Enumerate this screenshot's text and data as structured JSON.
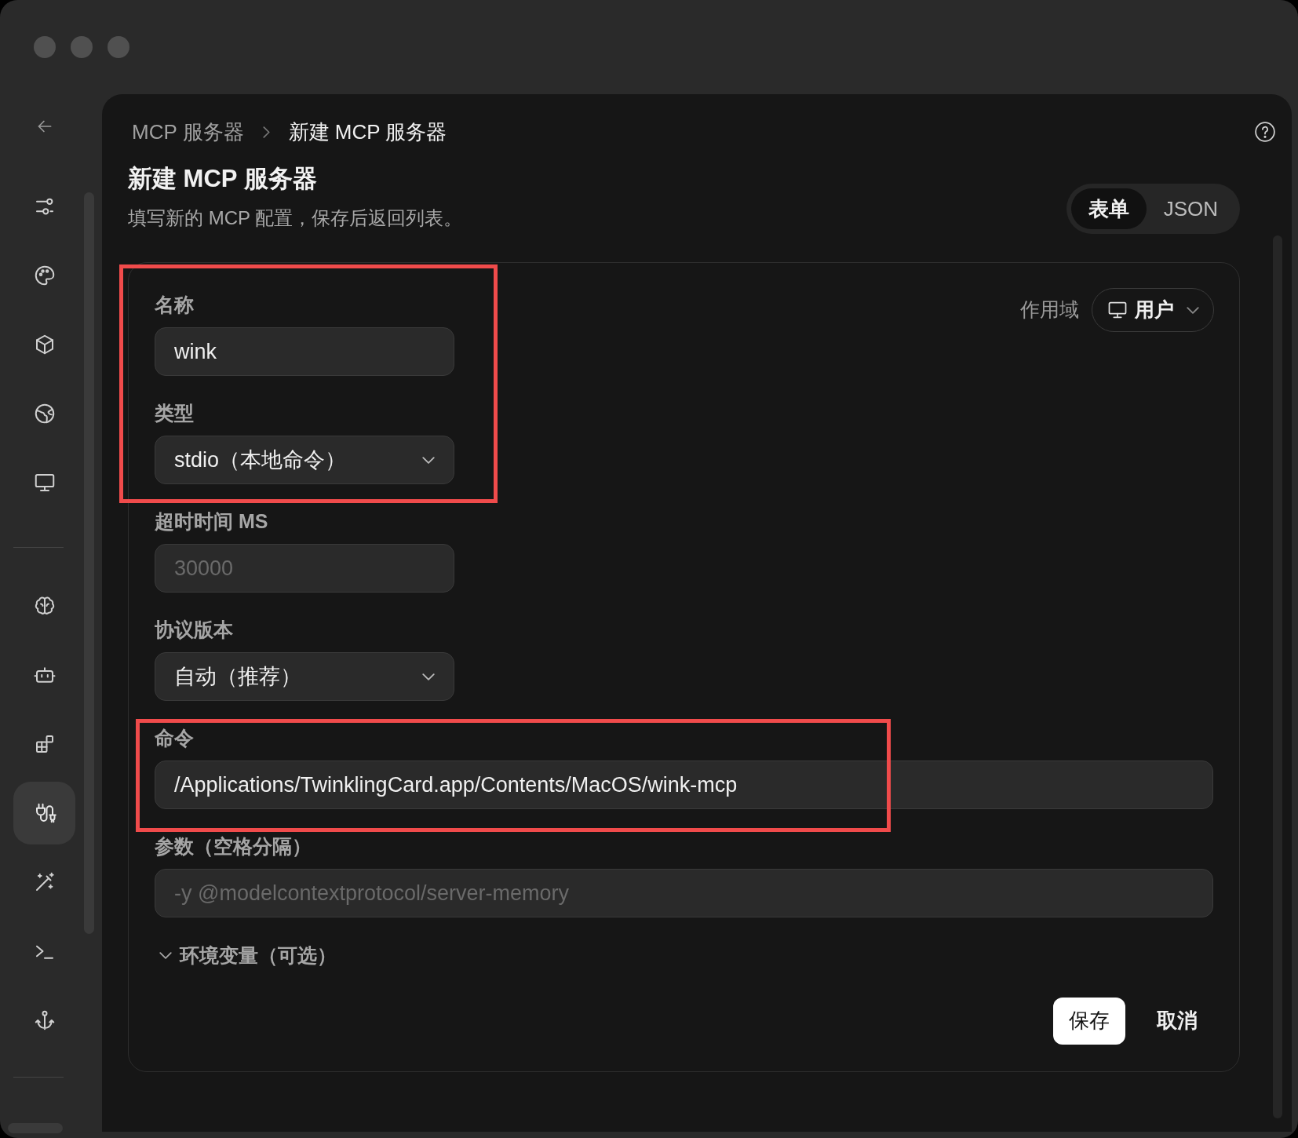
{
  "sidebar": {
    "items": [
      {
        "selected": false
      },
      {
        "selected": false
      },
      {
        "selected": false
      },
      {
        "selected": false
      },
      {
        "selected": false
      },
      {
        "selected": false
      },
      {
        "selected": false
      },
      {
        "selected": false
      },
      {
        "selected": true
      },
      {
        "selected": false
      },
      {
        "selected": false
      },
      {
        "selected": false
      }
    ]
  },
  "breadcrumb": [
    "MCP 服务器",
    "新建 MCP 服务器"
  ],
  "title": "新建 MCP 服务器",
  "subtitle": "填写新的 MCP 配置，保存后返回列表。",
  "mode_tabs": [
    {
      "label": "表单",
      "selected": true
    },
    {
      "label": "JSON",
      "selected": false
    }
  ],
  "scope": {
    "label": "作用域",
    "value": "用户"
  },
  "fields": [
    {
      "label": "名称",
      "kind": "text",
      "value": "wink",
      "wide": false
    },
    {
      "label": "类型",
      "kind": "select",
      "value": "stdio（本地命令）",
      "wide": false
    },
    {
      "label": "超时时间 MS",
      "kind": "text",
      "placeholder": "30000",
      "wide": false
    },
    {
      "label": "协议版本",
      "kind": "select",
      "value": "自动（推荐）",
      "wide": false
    },
    {
      "label": "命令",
      "kind": "text",
      "value": "/Applications/TwinklingCard.app/Contents/MacOS/wink-mcp",
      "wide": true
    },
    {
      "label": "参数（空格分隔）",
      "kind": "text",
      "placeholder": "-y @modelcontextprotocol/server-memory",
      "wide": true
    }
  ],
  "env_section": {
    "label": "环境变量（可选）"
  },
  "buttons": [
    {
      "label": "保存",
      "kind": "primary"
    },
    {
      "label": "取消",
      "kind": "secondary"
    }
  ],
  "annotations": [
    {
      "kind": "highlight-box"
    },
    {
      "kind": "highlight-box"
    }
  ]
}
